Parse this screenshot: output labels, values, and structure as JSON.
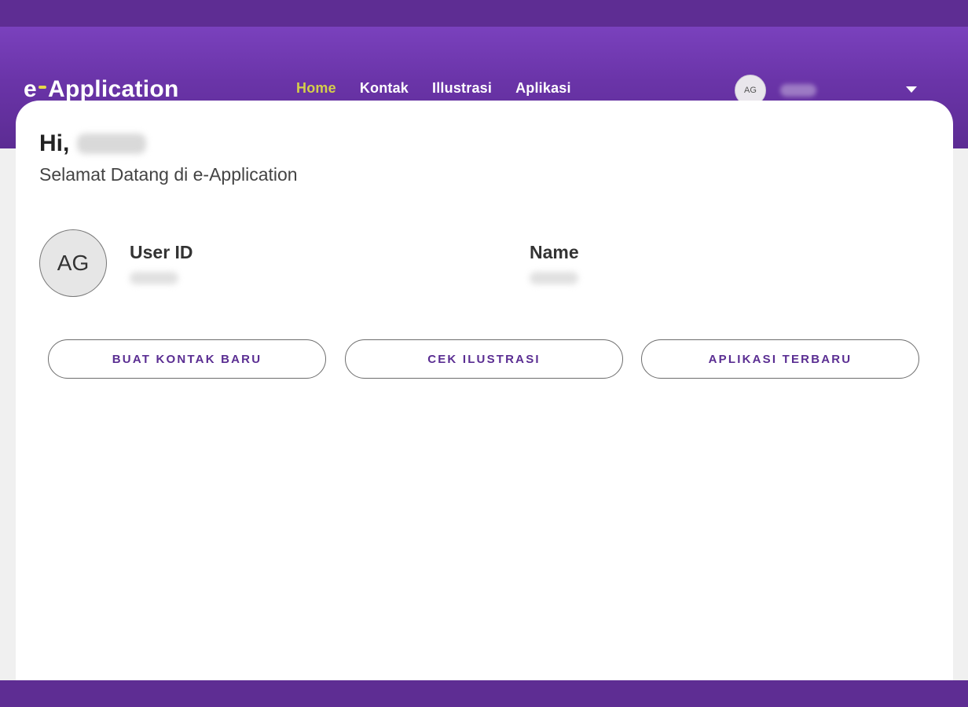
{
  "header": {
    "brand": {
      "prefix": "e",
      "name": "Application"
    },
    "nav": [
      {
        "label": "Home",
        "active": true
      },
      {
        "label": "Kontak",
        "active": false
      },
      {
        "label": "Illustrasi",
        "active": false
      },
      {
        "label": "Aplikasi",
        "active": false
      }
    ],
    "user": {
      "initials": "AG",
      "icon": "chevron-down-icon"
    }
  },
  "main": {
    "greeting": "Hi,",
    "subtitle": "Selamat Datang di e-Application",
    "profile": {
      "initials": "AG",
      "user_id_label": "User ID",
      "name_label": "Name"
    },
    "actions": [
      {
        "label": "BUAT KONTAK BARU"
      },
      {
        "label": "CEK ILUSTRASI"
      },
      {
        "label": "APLIKASI TERBARU"
      }
    ]
  },
  "colors": {
    "primary": "#6a34a8",
    "bar": "#5e2d93",
    "accent": "#d4cf4a",
    "button_text": "#5a2d92"
  }
}
